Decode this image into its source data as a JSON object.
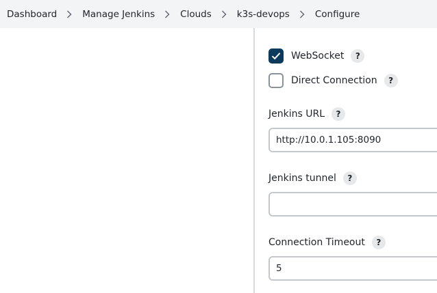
{
  "breadcrumb": {
    "items": [
      "Dashboard",
      "Manage Jenkins",
      "Clouds",
      "k3s-devops",
      "Configure"
    ]
  },
  "form": {
    "websocket": {
      "label": "WebSocket",
      "checked": true,
      "help": "?"
    },
    "direct_connection": {
      "label": "Direct Connection",
      "checked": false,
      "help": "?"
    },
    "jenkins_url": {
      "label": "Jenkins URL",
      "value": "http://10.0.1.105:8090",
      "help": "?"
    },
    "jenkins_tunnel": {
      "label": "Jenkins tunnel",
      "value": "",
      "help": "?"
    },
    "connection_timeout": {
      "label": "Connection Timeout",
      "value": "5",
      "help": "?"
    }
  },
  "colors": {
    "checkbox_checked": "#0b3a5c",
    "breadcrumb_bg": "#f3f4f6",
    "divider": "#d6d9de"
  }
}
